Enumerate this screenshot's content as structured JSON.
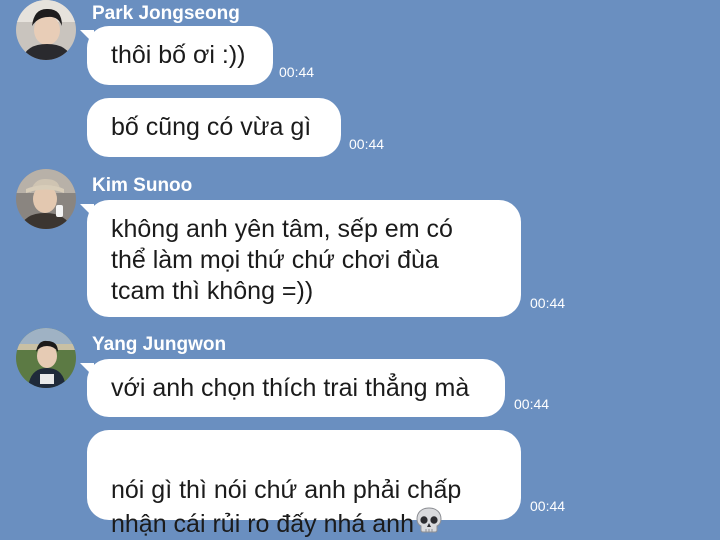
{
  "theme": {
    "background": "#6a8fc0",
    "bubble": "#ffffff",
    "text": "#1b1b1b",
    "meta_text": "#ffffff"
  },
  "messages": [
    {
      "sender": "Park Jongseong",
      "bubbles": [
        {
          "text": "thôi bố ơi :))",
          "time": "00:44"
        },
        {
          "text": "bố cũng có vừa gì",
          "time": "00:44"
        }
      ]
    },
    {
      "sender": "Kim Sunoo",
      "bubbles": [
        {
          "text": "không anh yên tâm, sếp em có\nthể làm mọi thứ chứ chơi đùa\ntcam thì không =))",
          "time": "00:44"
        }
      ]
    },
    {
      "sender": "Yang Jungwon",
      "bubbles": [
        {
          "text": "với anh chọn thích trai thẳng mà",
          "time": "00:44"
        },
        {
          "text": "nói gì thì nói chứ anh phải chấp\nnhận cái rủi ro đấy nhá anh",
          "emoji": "skull-icon",
          "time": "00:44"
        }
      ]
    }
  ]
}
